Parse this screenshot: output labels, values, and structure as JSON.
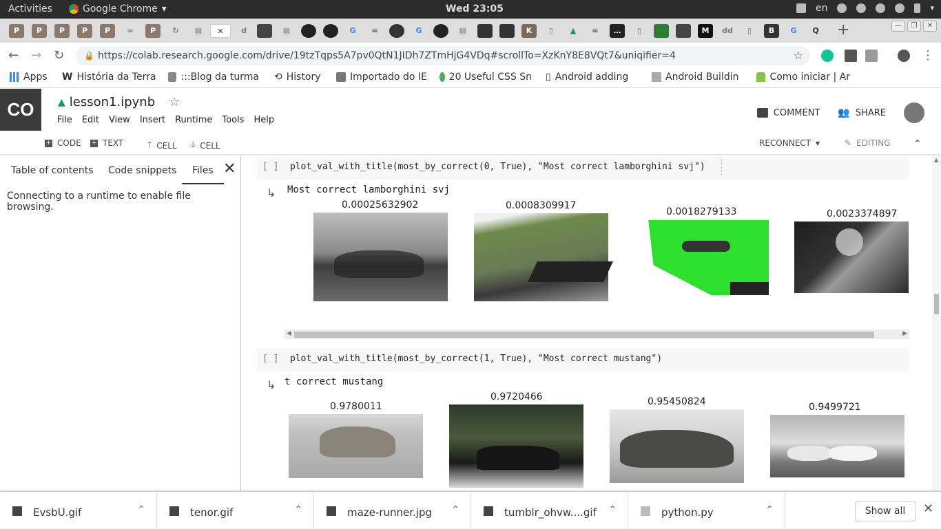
{
  "system_bar": {
    "activities": "Activities",
    "app_name": "Google Chrome",
    "clock": "Wed 23:05",
    "language": "en"
  },
  "browser": {
    "url": "https://colab.research.google.com/drive/19tzTqps5A7pv0QtN1JIDh7ZTmHjG4VDq#scrollTo=XzKnY8E8VQt7&uniqifier=4",
    "bookmarks": [
      "Apps",
      "História da Terra",
      ":::Blog da turma",
      "History",
      "Importado do IE",
      "20 Useful CSS Sn",
      "Android adding",
      "Android Buildin",
      "Como iniciar | Ar"
    ]
  },
  "colab": {
    "logo": "CO",
    "notebook_title": "lesson1.ipynb",
    "menu": [
      "File",
      "Edit",
      "View",
      "Insert",
      "Runtime",
      "Tools",
      "Help"
    ],
    "comment": "COMMENT",
    "share": "SHARE",
    "toolbar": {
      "code": "CODE",
      "text": "TEXT",
      "cell_up": "CELL",
      "cell_down": "CELL",
      "reconnect": "RECONNECT",
      "editing": "EDITING"
    }
  },
  "sidebar": {
    "tabs": [
      "Table of contents",
      "Code snippets",
      "Files"
    ],
    "active_tab": "Files",
    "message": "Connecting to a runtime to enable file browsing."
  },
  "cells": [
    {
      "bracket": "[ ]",
      "code": "plot_val_with_title(most_by_correct(0, True), \"Most correct lamborghini svj\")",
      "output_title": "Most correct lamborghini svj",
      "labels": [
        "0.00025632902",
        "0.0008309917",
        "0.0018279133",
        "0.0023374897"
      ]
    },
    {
      "bracket": "[ ]",
      "code": "plot_val_with_title(most_by_correct(1, True), \"Most correct mustang\")",
      "output_title": "t correct mustang",
      "labels": [
        "0.9780011",
        "0.9720466",
        "0.95450824",
        "0.9499721"
      ]
    }
  ],
  "downloads": {
    "items": [
      "EvsbU.gif",
      "tenor.gif",
      "maze-runner.jpg",
      "tumblr_ohvw....gif",
      "python.py"
    ],
    "show_all": "Show all"
  }
}
